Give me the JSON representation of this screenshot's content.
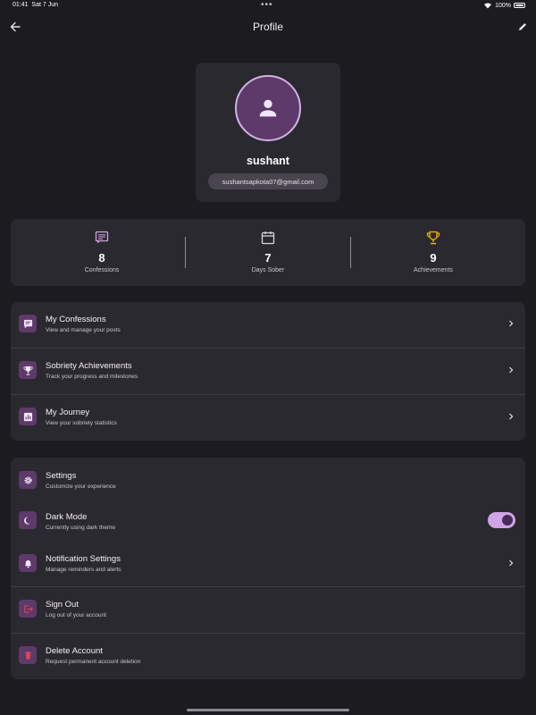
{
  "status_bar": {
    "time": "01:41",
    "date": "Sat 7 Jun",
    "dots": "•••",
    "battery": "100%"
  },
  "app_bar": {
    "title": "Profile"
  },
  "profile": {
    "username": "sushant",
    "email": "sushantsapkota07@gmail.com"
  },
  "stats": [
    {
      "value": "8",
      "label": "Confessions",
      "icon": "chat-icon"
    },
    {
      "value": "7",
      "label": "Days Sober",
      "icon": "calendar-icon"
    },
    {
      "value": "9",
      "label": "Achievements",
      "icon": "trophy-icon"
    }
  ],
  "menu": [
    {
      "title": "My Confessions",
      "subtitle": "View and manage your posts",
      "icon": "message-icon"
    },
    {
      "title": "Sobriety Achievements",
      "subtitle": "Track your progress and milestones",
      "icon": "trophy-icon"
    },
    {
      "title": "My Journey",
      "subtitle": "View your sobriety statistics",
      "icon": "chart-icon"
    }
  ],
  "settings": [
    {
      "title": "Settings",
      "subtitle": "Customize your experience",
      "icon": "gear-icon"
    },
    {
      "title": "Dark Mode",
      "subtitle": "Currently using dark theme",
      "icon": "moon-icon",
      "enabled": true
    },
    {
      "title": "Notification Settings",
      "subtitle": "Manage reminders and alerts",
      "icon": "bell-icon"
    },
    {
      "title": "Sign Out",
      "subtitle": "Log out of your account",
      "icon": "logout-icon"
    },
    {
      "title": "Delete Account",
      "subtitle": "Request permanent account deletion",
      "icon": "trash-icon"
    }
  ],
  "colors": {
    "background": "#1c1b1f",
    "card": "#2b2930",
    "accent": "#d0a4e6",
    "icon_bg": "#5d3a6a",
    "trophy": "#f4b400",
    "danger": "#e5484d"
  }
}
